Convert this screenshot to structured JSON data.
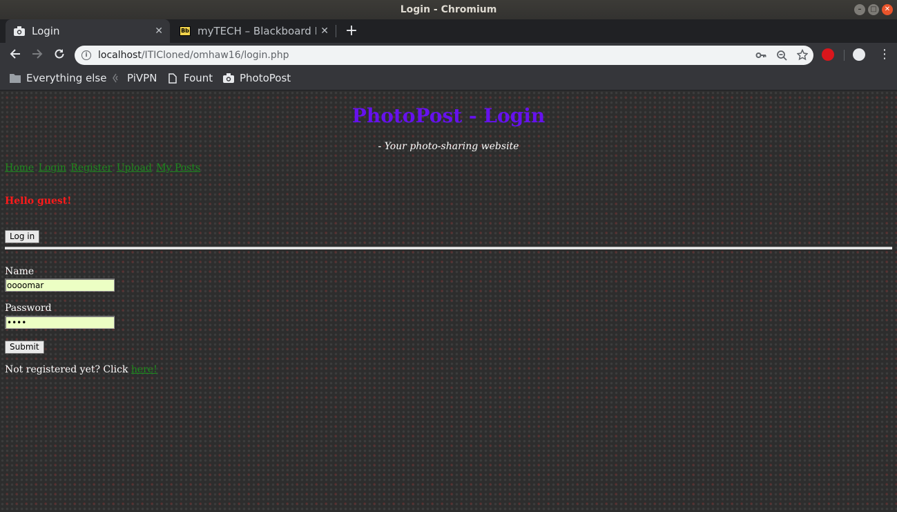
{
  "window": {
    "title": "Login - Chromium"
  },
  "tabs": [
    {
      "title": "Login",
      "close": "✕"
    },
    {
      "title": "myTECH – Blackboard Lea",
      "close": "✕",
      "favicon_text": "Bb"
    }
  ],
  "newtab_label": "+",
  "url": {
    "host": "localhost",
    "path": "/ITICloned/omhaw16/login.php"
  },
  "bookmarks": [
    "Everything else",
    "PiVPN",
    "Fount",
    "PhotoPost"
  ],
  "page": {
    "title": "PhotoPost - Login",
    "tagline": "- Your photo-sharing website",
    "nav": [
      "Home",
      "Login",
      "Register",
      "Upload",
      "My Posts"
    ],
    "greeting": "Hello guest!",
    "login_button": "Log in",
    "form": {
      "name_label": "Name",
      "name_value": "oooomar",
      "password_label": "Password",
      "password_value": "pass",
      "submit_label": "Submit"
    },
    "register_prompt": "Not registered yet? Click",
    "register_link": "here!"
  },
  "colors": {
    "title": "#6611ee",
    "greeting": "#ff1a1a",
    "link": "#1d8a1d",
    "input_bg": "#ecffc4"
  }
}
